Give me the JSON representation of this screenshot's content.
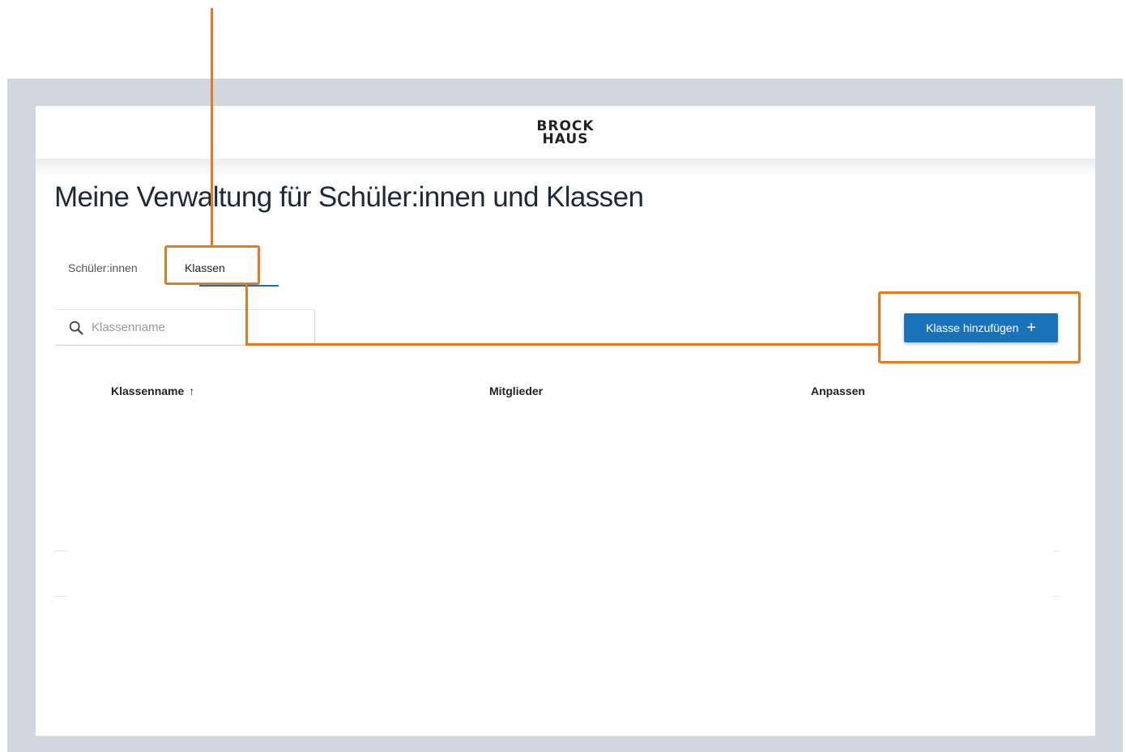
{
  "logo": {
    "line1": "BROCK",
    "line2": "HAUS"
  },
  "page": {
    "title": "Meine Verwaltung für Schüler:innen und Klassen"
  },
  "tabs": [
    {
      "label": "Schüler:innen",
      "active": false
    },
    {
      "label": "Klassen",
      "active": true
    }
  ],
  "search": {
    "placeholder": "Klassenname",
    "value": ""
  },
  "add_button": {
    "label": "Klasse hinzufügen",
    "icon": "plus-icon"
  },
  "table": {
    "columns": [
      {
        "label": "Klassenname",
        "sort": "ascending"
      },
      {
        "label": "Mitglieder"
      },
      {
        "label": "Anpassen"
      }
    ]
  },
  "colors": {
    "accent": "#1a73b8",
    "annotation": "#e07b22",
    "frame": "#d0d7de",
    "title": "#1e2a36"
  }
}
